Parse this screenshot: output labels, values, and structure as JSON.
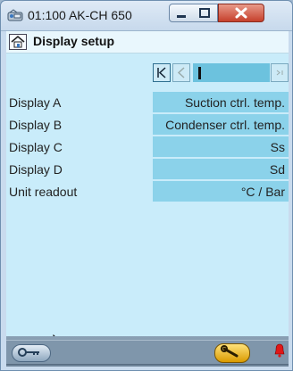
{
  "window": {
    "title": "01:100 AK-CH 650"
  },
  "header": {
    "title": "Display setup"
  },
  "pager": {
    "first_glyph": "|<",
    "prev_glyph": "<",
    "next_glyph": ">|"
  },
  "rows": [
    {
      "label": "Display A",
      "value": "Suction ctrl. temp."
    },
    {
      "label": "Display B",
      "value": "Condenser ctrl. temp."
    },
    {
      "label": "Display C",
      "value": "Ss"
    },
    {
      "label": "Display D",
      "value": "Sd"
    },
    {
      "label": "Unit readout",
      "value": "°C / Bar"
    }
  ],
  "icons": [
    "app-icon",
    "minimize-icon",
    "maximize-icon",
    "close-icon",
    "home-icon",
    "login-key-icon",
    "wrench-icon",
    "alarm-bell-icon",
    "mouse-pointer-icon"
  ]
}
